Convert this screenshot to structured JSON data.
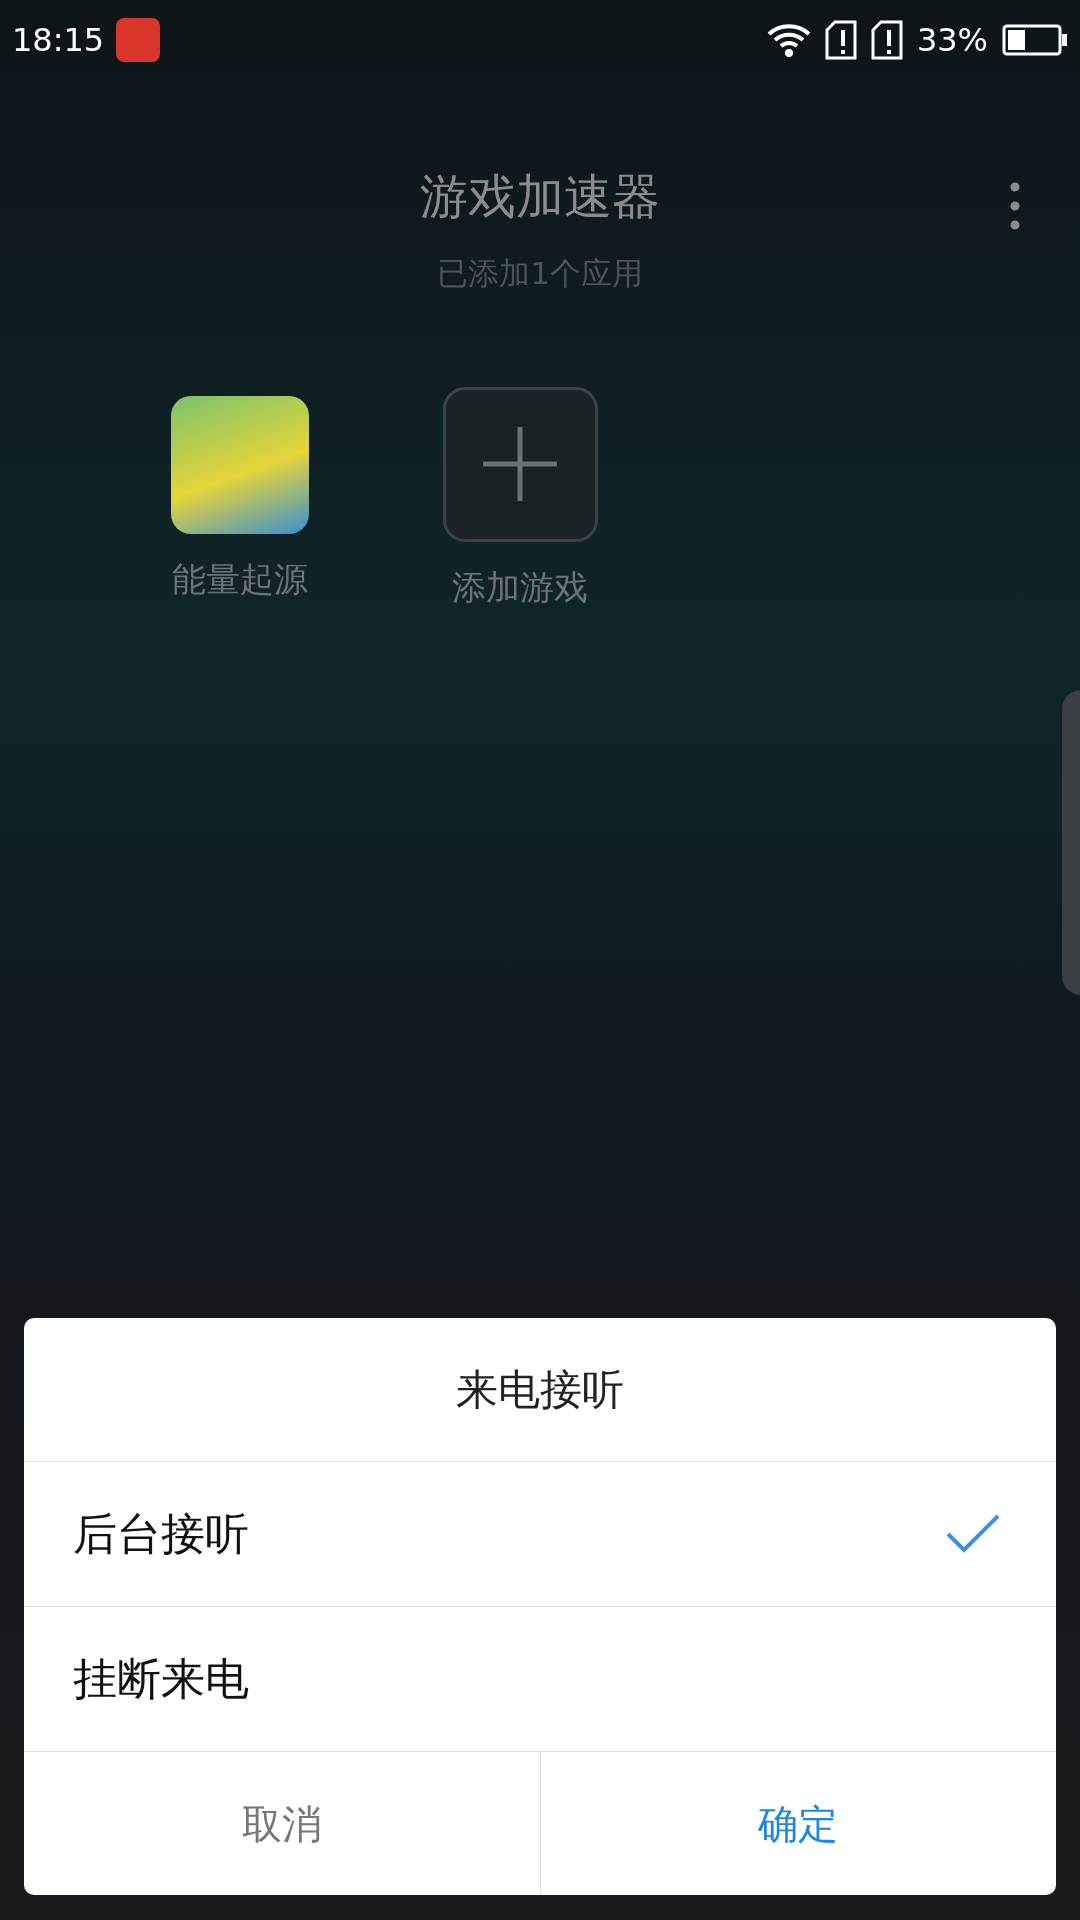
{
  "status_bar": {
    "time": "18:15",
    "battery": "33%"
  },
  "header": {
    "title": "游戏加速器",
    "subtitle": "已添加1个应用"
  },
  "apps": [
    {
      "kind": "app",
      "label": "能量起源"
    },
    {
      "kind": "add",
      "label": "添加游戏"
    }
  ],
  "dialog": {
    "title": "来电接听",
    "options": [
      {
        "label": "后台接听",
        "selected": true
      },
      {
        "label": "挂断来电",
        "selected": false
      }
    ],
    "buttons": [
      {
        "kind": "cancel",
        "label": "取消"
      },
      {
        "kind": "confirm",
        "label": "确定"
      }
    ]
  }
}
